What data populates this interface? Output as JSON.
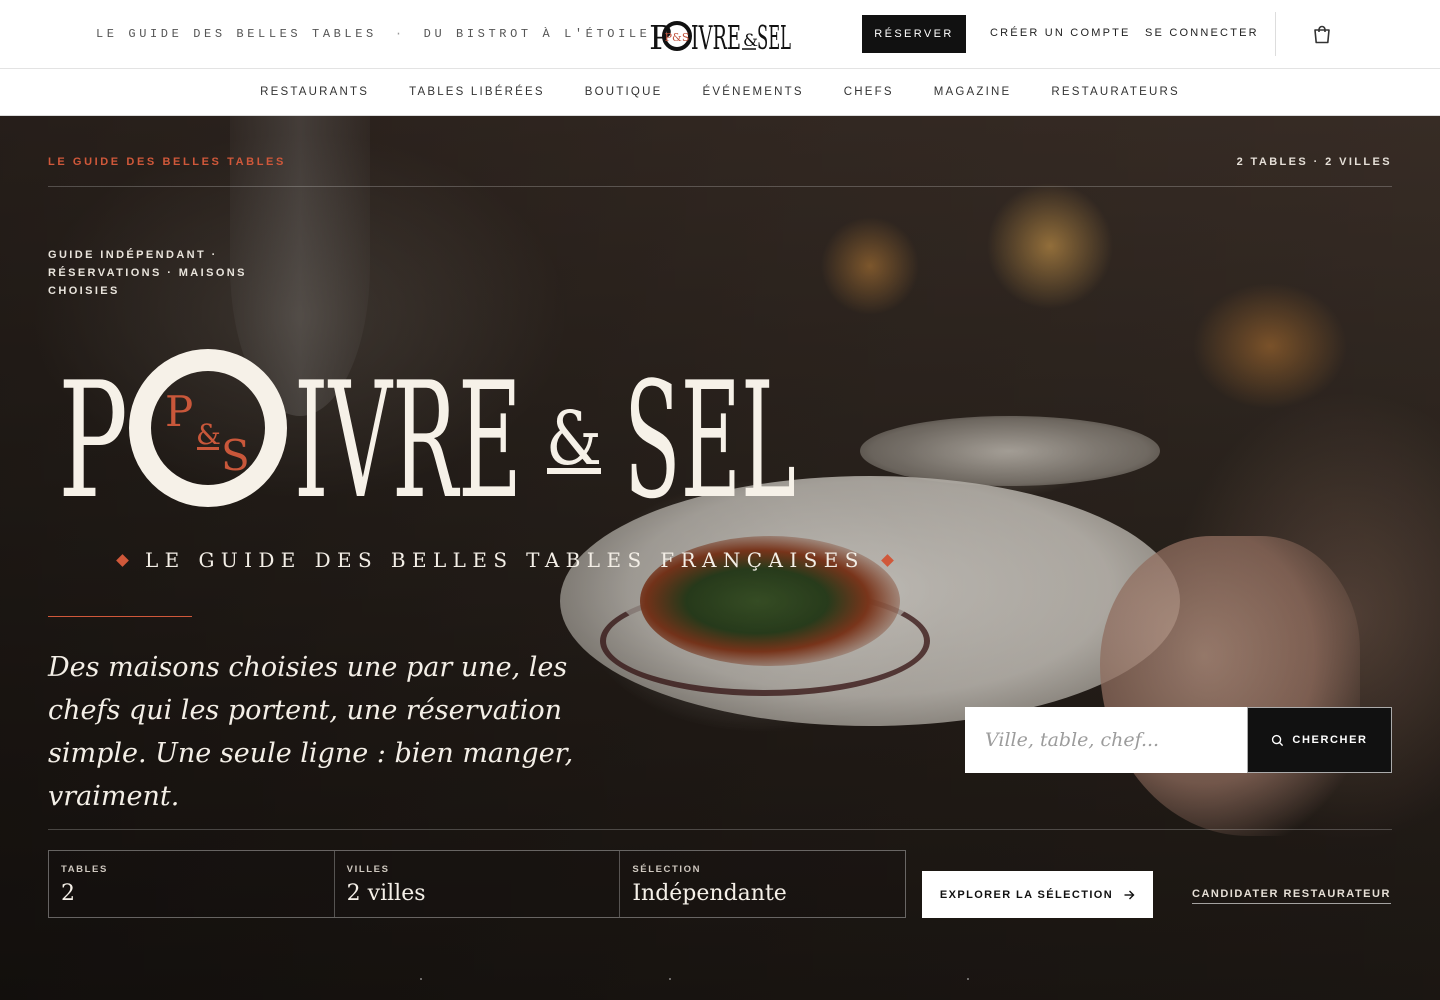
{
  "header": {
    "tagline_left": "LE GUIDE DES BELLES TABLES",
    "tagline_separator": "·",
    "tagline_right": "DU BISTROT À L'ÉTOILE",
    "brand": "POIVRE & SEL",
    "brand_monogram": "P&S",
    "reserve_label": "RÉSERVER",
    "create_account_label": "CRÉER UN COMPTE",
    "login_label": "SE CONNECTER",
    "cart_icon": "shopping-bag-icon"
  },
  "nav": {
    "items": [
      {
        "label": "RESTAURANTS"
      },
      {
        "label": "TABLES LIBÉRÉES"
      },
      {
        "label": "BOUTIQUE"
      },
      {
        "label": "ÉVÉNEMENTS"
      },
      {
        "label": "CHEFS"
      },
      {
        "label": "MAGAZINE"
      },
      {
        "label": "RESTAURATEURS"
      }
    ]
  },
  "hero": {
    "kicker": "LE GUIDE DES BELLES TABLES",
    "count": "2 TABLES · 2 VILLES",
    "meta": "GUIDE INDÉPENDANT · RÉSERVATIONS · MAISONS CHOISIES",
    "logo_text": "POIVRE & SEL",
    "subline": "LE GUIDE DES BELLES TABLES FRANÇAISES",
    "lede": "Des maisons choisies une par une, les chefs qui les portent, une réservation simple. Une seule ligne : bien manger, vraiment.",
    "search": {
      "placeholder": "Ville, table, chef...",
      "button_label": "CHERCHER",
      "icon": "search-icon"
    },
    "stats": [
      {
        "label": "TABLES",
        "value": "2"
      },
      {
        "label": "VILLES",
        "value": "2 villes"
      },
      {
        "label": "SÉLECTION",
        "value": "Indépendante"
      }
    ],
    "explore_label": "EXPLORER LA SÉLECTION",
    "explore_icon": "arrow-right-icon",
    "candidate_label": "CANDIDATER RESTAURATEUR"
  },
  "colors": {
    "accent": "#d0583a",
    "cream": "#f3eee6",
    "ink": "#111111"
  }
}
